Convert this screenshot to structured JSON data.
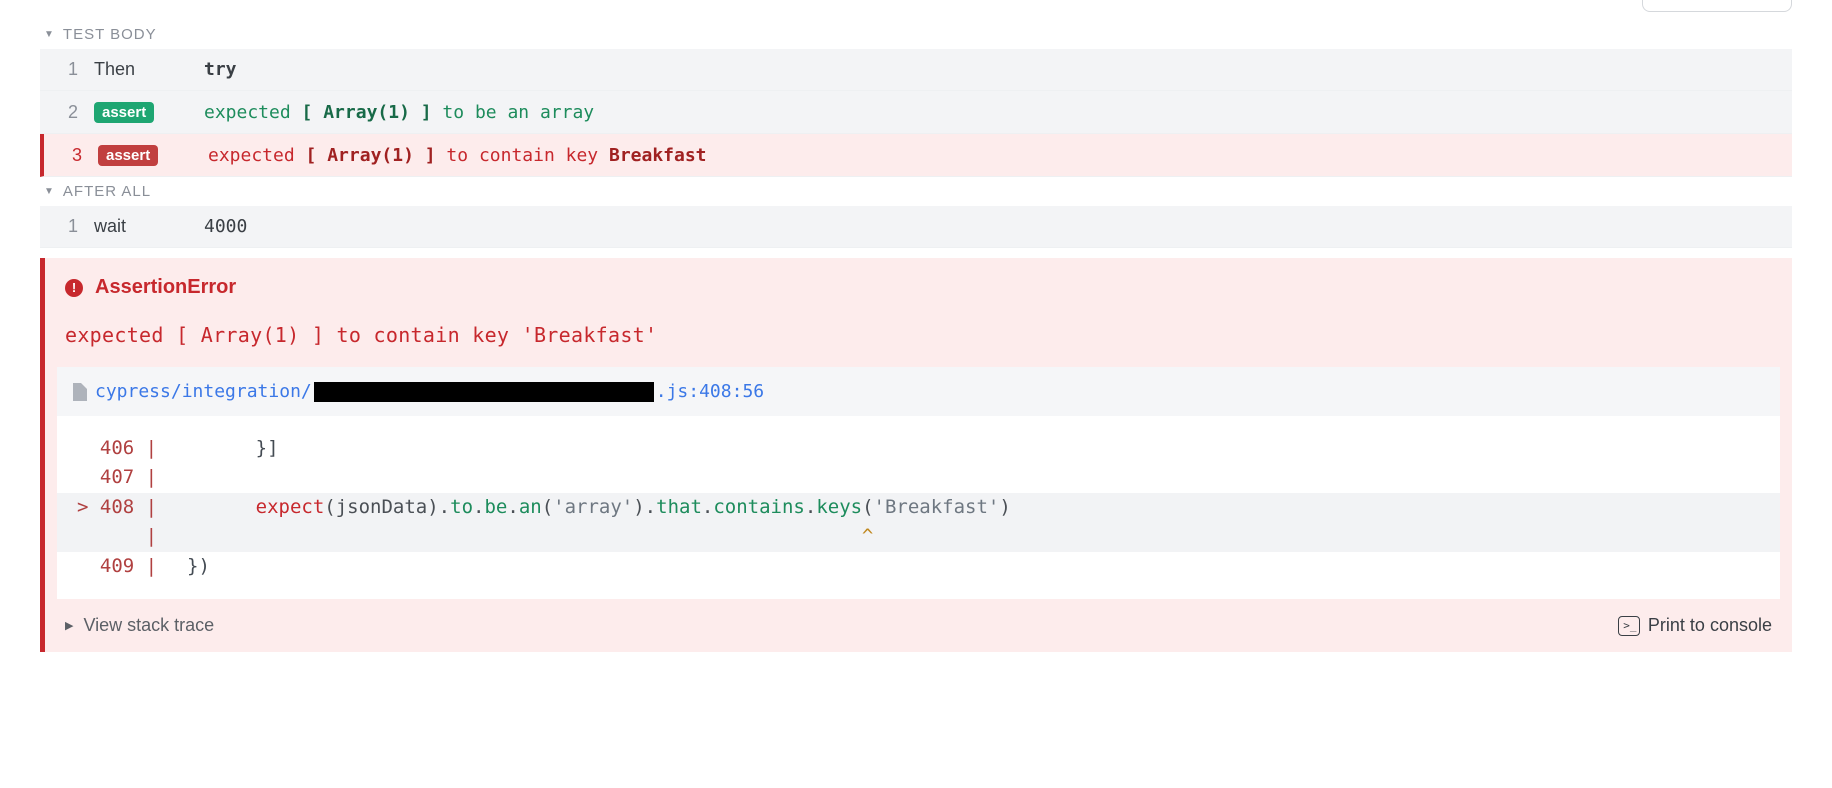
{
  "sections": {
    "test_body_label": "TEST BODY",
    "after_all_label": "AFTER ALL"
  },
  "command_log": [
    {
      "num": "1",
      "command": "Then",
      "type": "plain",
      "message_plain": "try"
    },
    {
      "num": "2",
      "command_badge": "assert",
      "type": "pass",
      "msg_pre": "expected ",
      "msg_val": "[ Array(1) ]",
      "msg_post": " to be an array"
    },
    {
      "num": "3",
      "command_badge": "assert",
      "type": "fail",
      "msg_pre": "expected ",
      "msg_val": "[ Array(1) ]",
      "msg_mid": " to contain key ",
      "msg_key": "Breakfast"
    }
  ],
  "after_all_log": [
    {
      "num": "1",
      "command": "wait",
      "message_plain": "4000"
    }
  ],
  "error": {
    "title": "AssertionError",
    "message": "expected [ Array(1) ] to contain key 'Breakfast'",
    "file_prefix": "cypress/integration/",
    "file_suffix": ".js:408:56",
    "view_stack_trace": "View stack trace",
    "print_to_console": "Print to console"
  },
  "codeframe": {
    "l406_gutter": "  406 | ",
    "l406_code": "      }]",
    "l407_gutter": "  407 | ",
    "l407_code": "",
    "l408_gutter_pre": "> ",
    "l408_gutter": "408 | ",
    "l408_indent": "      ",
    "l408_expect": "expect",
    "l408_p1": "(jsonData).",
    "l408_to": "to",
    "l408_d1": ".",
    "l408_be": "be",
    "l408_d2": ".",
    "l408_an": "an",
    "l408_p2": "(",
    "l408_s1": "'array'",
    "l408_p3": ").",
    "l408_that": "that",
    "l408_d3": ".",
    "l408_contains": "contains",
    "l408_d4": ".",
    "l408_keys": "keys",
    "l408_p4": "(",
    "l408_s2": "'Breakfast'",
    "l408_p5": ")",
    "caret_gutter": "      | ",
    "caret_pad": "                                                           ",
    "caret": "^",
    "l409_gutter": "  409 | ",
    "l409_code": "})"
  }
}
